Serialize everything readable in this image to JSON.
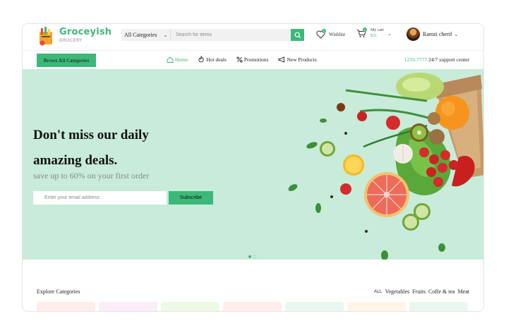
{
  "brand": {
    "name": "Groceyish",
    "tagline": "GROCERY"
  },
  "search": {
    "category": "All Categories",
    "placeholder": "Search for items"
  },
  "header": {
    "wishlist_label": "Wishlist",
    "wishlist_count": "0",
    "cart_label": "My cart",
    "cart_price": "$21",
    "cart_count": "0",
    "user_name": "Ramzi cherif"
  },
  "nav": {
    "browse_label": "Brows All Categories",
    "links": [
      {
        "label": "Home",
        "icon": "home-icon",
        "active": true
      },
      {
        "label": "Hot deals",
        "icon": "flame-icon"
      },
      {
        "label": "Promotions",
        "icon": "percent-icon"
      },
      {
        "label": "New Products",
        "icon": "megaphone-icon"
      }
    ],
    "support_phone": "1233-7777",
    "support_text": "24/7 support center"
  },
  "hero": {
    "title_line1": "Don't miss our daily",
    "title_line2": "amazing deals.",
    "subtitle": "save up to 60% on your first order",
    "email_placeholder": "Enter your email address",
    "subscribe_label": "Subscribe",
    "slides_total": 2,
    "active_slide": 1
  },
  "categories": {
    "title": "Explore Categories",
    "filters": [
      "ALL",
      "Vegetables",
      "Fruits",
      "Coffe & tea",
      "Meat"
    ],
    "card_colors": [
      "#fdeeea",
      "#fbeefb",
      "#eef9e6",
      "#fdeeea",
      "#eaf7ee",
      "#fdf6e8",
      "#eaf7ee"
    ]
  },
  "colors": {
    "accent": "#3cb878",
    "hero_bg": "#c8ebda"
  }
}
